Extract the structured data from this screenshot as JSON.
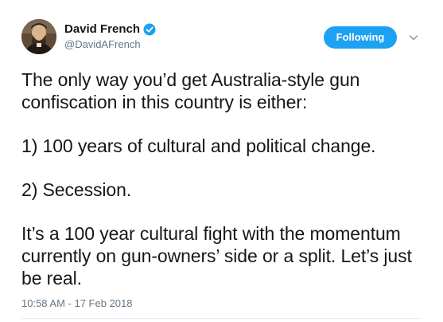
{
  "author": {
    "display_name": "David French",
    "handle": "@DavidAFrench",
    "verified": true,
    "avatar_icon": "portrait-avatar"
  },
  "follow_button": {
    "label": "Following",
    "color": "#1da1f2"
  },
  "menu": {
    "icon": "chevron-down-icon"
  },
  "tweet": {
    "paragraphs": [
      "The only way you’d get Australia-style gun confiscation in this country is either:",
      "1) 100 years of cultural and political change.",
      "2) Secession.",
      "It’s a 100 year cultural fight with the momentum currently on gun-owners’ side or a split. Let’s just be real."
    ],
    "timestamp": "10:58 AM - 17 Feb 2018"
  },
  "colors": {
    "text": "#14171a",
    "secondary": "#657786",
    "accent": "#1da1f2",
    "divider": "#e6ecf0"
  }
}
